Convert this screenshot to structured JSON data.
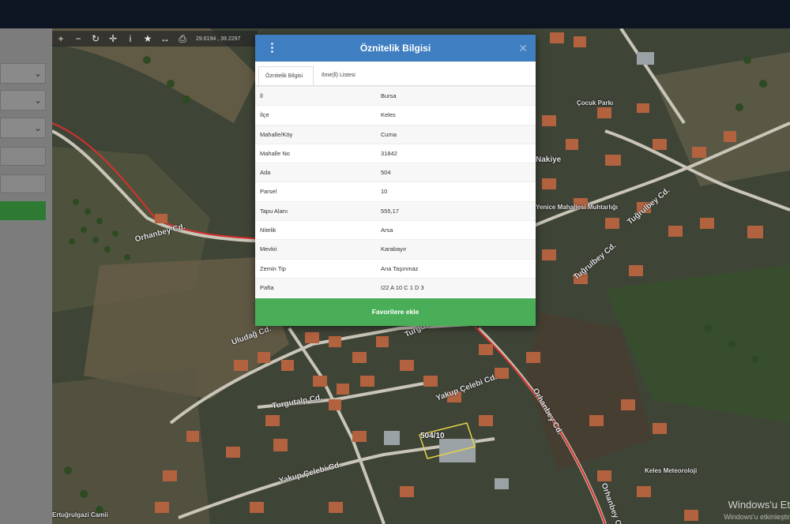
{
  "dialog": {
    "title": "Öznitelik Bilgisi",
    "menu_icon": "kebab-menu-icon",
    "close_icon": "close-icon",
    "tabs": [
      "Öznitelik Bilgisi",
      "Ilme(ll) Listesi"
    ],
    "rows": [
      {
        "key": "İl",
        "value": "Bursa"
      },
      {
        "key": "İlçe",
        "value": "Keles"
      },
      {
        "key": "Mahalle/Köy",
        "value": "Cuma"
      },
      {
        "key": "Mahalle No",
        "value": "31842"
      },
      {
        "key": "Ada",
        "value": "504"
      },
      {
        "key": "Parsel",
        "value": "10"
      },
      {
        "key": "Tapu Alanı",
        "value": "555,17"
      },
      {
        "key": "Nitelik",
        "value": "Arsa"
      },
      {
        "key": "Mevkii",
        "value": "Karabayır"
      },
      {
        "key": "Zemin Tip",
        "value": "Ana Taşınmaz"
      },
      {
        "key": "Pafta",
        "value": "I22 A 10 C 1 D 3"
      }
    ],
    "favorite_button": "Favorilere ekle"
  },
  "toolbar": {
    "icons": [
      "zoom-in-icon",
      "zoom-out-icon",
      "refresh-icon",
      "crosshair-icon",
      "info-icon",
      "star-icon",
      "measure-icon",
      "print-icon"
    ],
    "coordinates": "29.6194 , 39.2297"
  },
  "map": {
    "parcel_label": "504/10",
    "road_labels": [
      "Orhanbey Cd.",
      "Uludağ Cd.",
      "Turgutalp Cd.",
      "Turgutalp Cd.",
      "Yakup Çelebi Cd.",
      "Yakup Çelebi Cd.",
      "Orhanbey Cd.",
      "Tuğrulbey Cd.",
      "Tuğrulbey Cd.",
      "Orhanbey Cd."
    ],
    "poi_labels": [
      "Nakiye",
      "Yenice Mahallesi Muhtarlığı",
      "Ertuğrulgazi Camii",
      "Keles Meteoroloji",
      "Çocuk Parkı"
    ]
  },
  "watermark": {
    "line1": "Windows'u Et",
    "line2": "Windows'u etkinleştir"
  }
}
